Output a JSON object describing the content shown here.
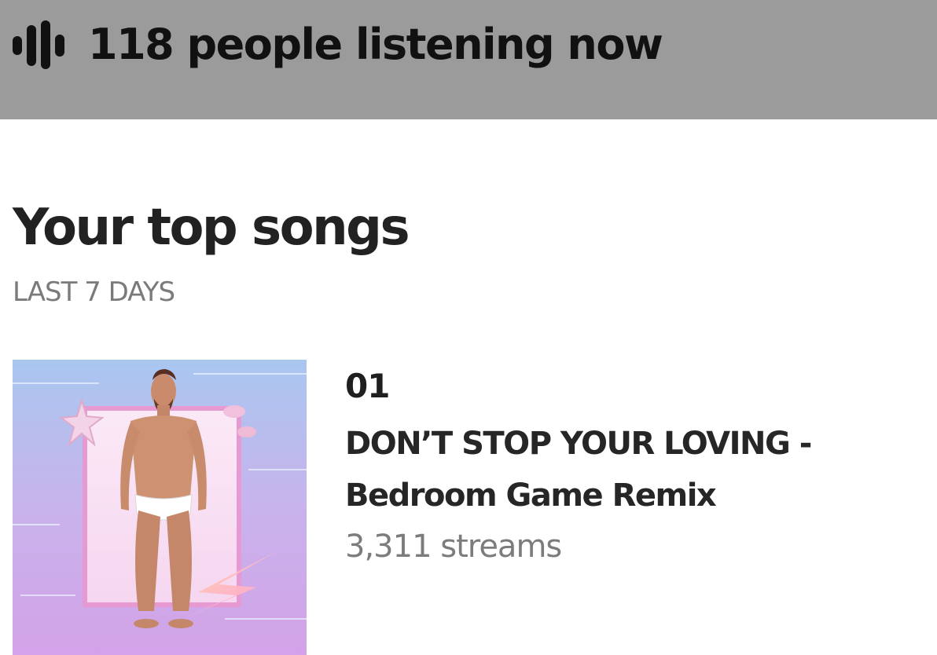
{
  "header": {
    "icon": "audio-bars-icon",
    "listening_text": "118 people listening now",
    "background_color": "#9b9b9b"
  },
  "top_songs": {
    "title": "Your top songs",
    "period": "LAST 7 DAYS",
    "items": [
      {
        "rank": "01",
        "title": "DON’T STOP YOUR LOVING - Bedroom Game Remix",
        "streams": "3,311 streams",
        "cover_art": "album-cover-image"
      }
    ]
  }
}
